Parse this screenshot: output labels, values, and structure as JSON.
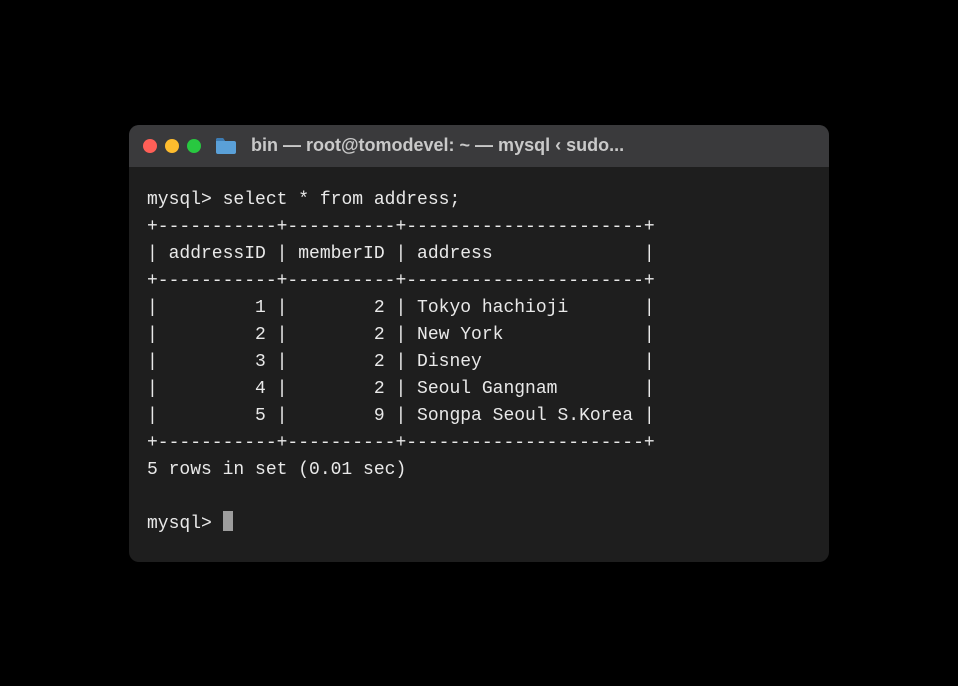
{
  "window": {
    "title": "bin — root@tomodevel: ~ — mysql ‹ sudo..."
  },
  "terminal": {
    "prompt": "mysql>",
    "command": "select * from address;",
    "status": "5 rows in set (0.01 sec)",
    "table": {
      "columns": [
        "addressID",
        "memberID",
        "address"
      ],
      "rows": [
        {
          "addressID": 1,
          "memberID": 2,
          "address": "Tokyo hachioji"
        },
        {
          "addressID": 2,
          "memberID": 2,
          "address": "New York"
        },
        {
          "addressID": 3,
          "memberID": 2,
          "address": "Disney"
        },
        {
          "addressID": 4,
          "memberID": 2,
          "address": "Seoul Gangnam"
        },
        {
          "addressID": 5,
          "memberID": 9,
          "address": "Songpa Seoul S.Korea"
        }
      ]
    }
  },
  "colors": {
    "bg": "#000000",
    "windowBg": "#1e1e1e",
    "titlebarBg": "#3a3a3c",
    "text": "#e9e9e9",
    "red": "#ff5f57",
    "yellow": "#febc2e",
    "green": "#28c840"
  }
}
